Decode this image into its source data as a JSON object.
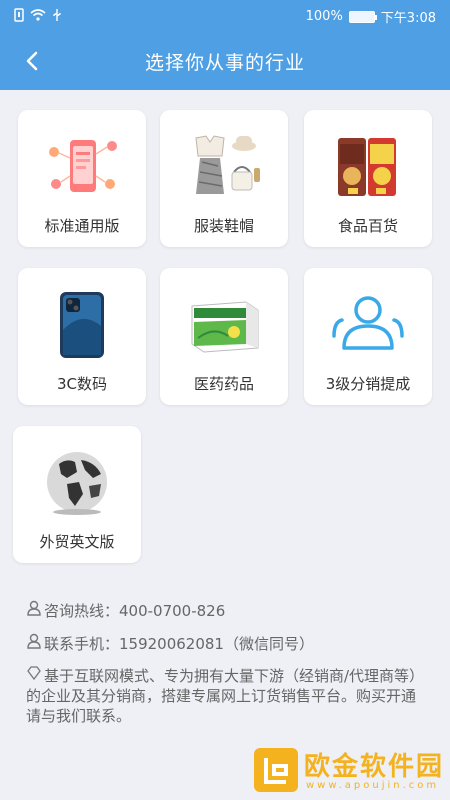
{
  "status_bar": {
    "battery": "100%",
    "time": "下午3:08",
    "icons": [
      "sim-icon",
      "wifi-icon",
      "usb-icon",
      "battery-icon"
    ]
  },
  "header": {
    "title": "选择你从事的行业",
    "back_icon": "chevron-left-icon"
  },
  "industries": [
    {
      "label": "标准通用版",
      "icon": "phone-network-icon"
    },
    {
      "label": "服装鞋帽",
      "icon": "clothing-icon"
    },
    {
      "label": "食品百货",
      "icon": "snack-icon"
    },
    {
      "label": "3C数码",
      "icon": "smartphone-icon"
    },
    {
      "label": "医药药品",
      "icon": "medicine-box-icon"
    },
    {
      "label": "3级分销提成",
      "icon": "users-icon"
    },
    {
      "label": "外贸英文版",
      "icon": "globe-icon"
    }
  ],
  "contact": {
    "hotline": "咨询热线：400-0700-826",
    "mobile": "联系手机：15920062081（微信同号）",
    "description": "基于互联网模式、专为拥有大量下游（经销商/代理商等）的企业及其分销商，搭建专属网上订货销售平台。购买开通请与我们联系。"
  },
  "watermark": {
    "name": "欧金软件园",
    "url": "www.apoujin.com"
  },
  "colors": {
    "primary": "#4f9fe4",
    "background": "#eef0f6",
    "watermark": "#f4b21f"
  }
}
